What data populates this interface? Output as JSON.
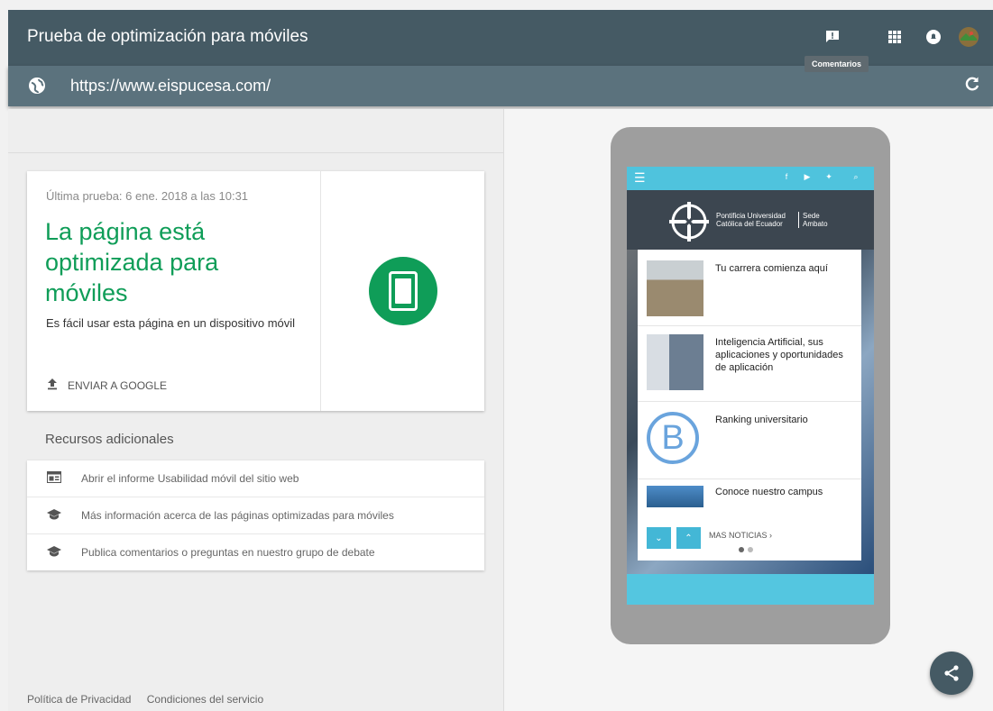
{
  "app": {
    "title": "Prueba de optimización para móviles",
    "tooltip": "Comentarios",
    "url": "https://www.eispucesa.com/"
  },
  "result": {
    "last_test": "Última prueba: 6 ene. 2018 a las 10:31",
    "headline": "La página está optimizada para móviles",
    "description": "Es fácil usar esta página en un dispositivo móvil",
    "send_label": "ENVIAR A GOOGLE",
    "status_color": "#0f9d58"
  },
  "resources": {
    "title": "Recursos adicionales",
    "items": [
      {
        "icon": "report-icon",
        "label": "Abrir el informe Usabilidad móvil del sitio web"
      },
      {
        "icon": "school-icon",
        "label": "Más información acerca de las páginas optimizadas para móviles"
      },
      {
        "icon": "school-icon",
        "label": "Publica comentarios o preguntas en nuestro grupo de debate"
      }
    ]
  },
  "footer": {
    "privacy": "Política de Privacidad",
    "terms": "Condiciones del servicio"
  },
  "preview": {
    "university_line1": "Pontificia Universidad",
    "university_line2": "Católica del Ecuador",
    "sede_line1": "Sede",
    "sede_line2": "Ambato",
    "news": [
      "Tu carrera comienza aquí",
      "Inteligencia Artificial, sus aplicaciones y oportunidades de aplicación",
      "Ranking universitario",
      "Conoce nuestro campus"
    ],
    "more_label": "MAS NOTICIAS",
    "ranking_letter": "B",
    "social_icons": [
      "facebook-icon",
      "youtube-icon",
      "twitter-icon",
      "search-icon"
    ]
  }
}
